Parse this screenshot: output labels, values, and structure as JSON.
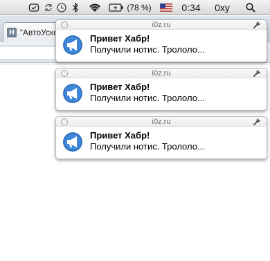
{
  "menubar": {
    "battery_percent": "(78 %)",
    "clock": "0:34",
    "user": "0xy",
    "icons": [
      "dropbox-icon",
      "sync-icon",
      "time-machine-icon",
      "bluetooth-icon",
      "wifi-icon",
      "battery-icon",
      "us-flag-icon",
      "spotlight-icon"
    ]
  },
  "browser": {
    "tab_favicon": "H",
    "tab_title": "“АвтоУскорен"
  },
  "notifications": [
    {
      "domain": "i0z.ru",
      "title": "Привет Хабр!",
      "body": "Получили нотис. Трололо..."
    },
    {
      "domain": "i0z.ru",
      "title": "Привет Хабр!",
      "body": "Получили нотис. Трололо..."
    },
    {
      "domain": "i0z.ru",
      "title": "Привет Хабр!",
      "body": "Получили нотис. Трололо..."
    }
  ],
  "colors": {
    "notif_icon": "#3d86d8",
    "flag_red": "#c0392b",
    "flag_blue": "#2c3e8f"
  }
}
